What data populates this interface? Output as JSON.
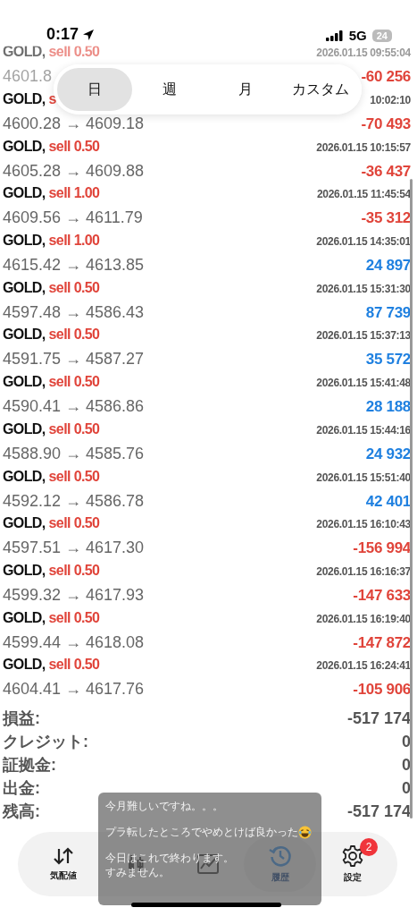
{
  "status_bar": {
    "time": "0:17",
    "network": "5G",
    "battery": "24"
  },
  "period_tabs": [
    {
      "label": "日",
      "selected": true
    },
    {
      "label": "週",
      "selected": false
    },
    {
      "label": "月",
      "selected": false
    },
    {
      "label": "カスタム",
      "selected": false
    }
  ],
  "deals": [
    {
      "symbol": "GOLD,",
      "order": "sell 0.50",
      "time": "2026.01.15 09:55:04",
      "prices": "4601.8",
      "profit": "-60 256",
      "color": "#e0443a",
      "faded": true
    },
    {
      "symbol": "GOLD,",
      "order": "s",
      "time": "10:02:10",
      "prices": "4600.28 → 4609.18",
      "profit": "-70 493",
      "color": "#e0443a",
      "faded": false
    },
    {
      "symbol": "GOLD,",
      "order": "sell 0.50",
      "time": "2026.01.15 10:15:57",
      "prices": "4605.28 → 4609.88",
      "profit": "-36 437",
      "color": "#e0443a",
      "faded": false
    },
    {
      "symbol": "GOLD,",
      "order": "sell 1.00",
      "time": "2026.01.15 11:45:54",
      "prices": "4609.56 → 4611.79",
      "profit": "-35 312",
      "color": "#e0443a",
      "faded": false
    },
    {
      "symbol": "GOLD,",
      "order": "sell 1.00",
      "time": "2026.01.15 14:35:01",
      "prices": "4615.42 → 4613.85",
      "profit": "24 897",
      "color": "#1f80e0",
      "faded": false
    },
    {
      "symbol": "GOLD,",
      "order": "sell 0.50",
      "time": "2026.01.15 15:31:30",
      "prices": "4597.48 → 4586.43",
      "profit": "87 739",
      "color": "#1f80e0",
      "faded": false
    },
    {
      "symbol": "GOLD,",
      "order": "sell 0.50",
      "time": "2026.01.15 15:37:13",
      "prices": "4591.75 → 4587.27",
      "profit": "35 572",
      "color": "#1f80e0",
      "faded": false
    },
    {
      "symbol": "GOLD,",
      "order": "sell 0.50",
      "time": "2026.01.15 15:41:48",
      "prices": "4590.41 → 4586.86",
      "profit": "28 188",
      "color": "#1f80e0",
      "faded": false
    },
    {
      "symbol": "GOLD,",
      "order": "sell 0.50",
      "time": "2026.01.15 15:44:16",
      "prices": "4588.90 → 4585.76",
      "profit": "24 932",
      "color": "#1f80e0",
      "faded": false
    },
    {
      "symbol": "GOLD,",
      "order": "sell 0.50",
      "time": "2026.01.15 15:51:40",
      "prices": "4592.12 → 4586.78",
      "profit": "42 401",
      "color": "#1f80e0",
      "faded": false
    },
    {
      "symbol": "GOLD,",
      "order": "sell 0.50",
      "time": "2026.01.15 16:10:43",
      "prices": "4597.51 → 4617.30",
      "profit": "-156 994",
      "color": "#e0443a",
      "faded": false
    },
    {
      "symbol": "GOLD,",
      "order": "sell 0.50",
      "time": "2026.01.15 16:16:37",
      "prices": "4599.32 → 4617.93",
      "profit": "-147 633",
      "color": "#e0443a",
      "faded": false
    },
    {
      "symbol": "GOLD,",
      "order": "sell 0.50",
      "time": "2026.01.15 16:19:40",
      "prices": "4599.44 → 4618.08",
      "profit": "-147 872",
      "color": "#e0443a",
      "faded": false
    },
    {
      "symbol": "GOLD,",
      "order": "sell 0.50",
      "time": "2026.01.15 16:24:41",
      "prices": "4604.41 → 4617.76",
      "profit": "-105 906",
      "color": "#e0443a",
      "faded": false
    }
  ],
  "summary": [
    {
      "label": "損益:",
      "value": "-517 174"
    },
    {
      "label": "クレジット:",
      "value": "0"
    },
    {
      "label": "証拠金:",
      "value": "0"
    },
    {
      "label": "出金:",
      "value": "0"
    },
    {
      "label": "残高:",
      "value": "-517 174"
    }
  ],
  "tab_bar": [
    {
      "kind": "quotes",
      "label": "気配値",
      "selected": false
    },
    {
      "kind": "chart",
      "selected": false
    },
    {
      "kind": "trade",
      "selected": false
    },
    {
      "kind": "history",
      "label": "履歴",
      "selected": true
    },
    {
      "kind": "settings",
      "label": "設定",
      "selected": false,
      "badge": "2"
    }
  ],
  "message_bubble": {
    "paragraphs": [
      {
        "lines": [
          "今月難しいですね。。。"
        ],
        "emoji": false
      },
      {
        "lines": [
          "プラ転したところでやめとけば良かった"
        ],
        "emoji": true
      },
      {
        "lines": [
          "今日はこれで終わります。",
          "すみません。"
        ],
        "emoji": false
      }
    ]
  }
}
